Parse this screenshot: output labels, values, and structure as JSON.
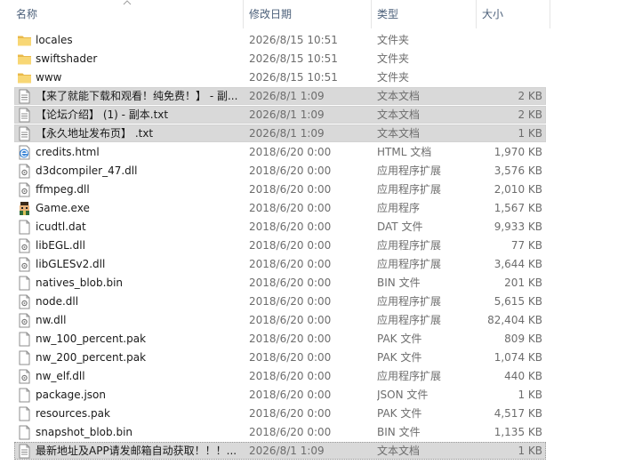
{
  "columns": {
    "name": "名称",
    "date": "修改日期",
    "type": "类型",
    "size": "大小"
  },
  "files": [
    {
      "name": "locales",
      "date": "2026/8/15 10:51",
      "type": "文件夹",
      "size": "",
      "icon": "folder-icon",
      "selected": false
    },
    {
      "name": "swiftshader",
      "date": "2026/8/15 10:51",
      "type": "文件夹",
      "size": "",
      "icon": "folder-icon",
      "selected": false
    },
    {
      "name": "www",
      "date": "2026/8/15 10:51",
      "type": "文件夹",
      "size": "",
      "icon": "folder-icon",
      "selected": false
    },
    {
      "name": "【来了就能下载和观看！纯免费！】 - 副...",
      "date": "2026/8/1 1:09",
      "type": "文本文档",
      "size": "2 KB",
      "icon": "text-file-icon",
      "selected": true
    },
    {
      "name": "【论坛介绍】 (1) - 副本.txt",
      "date": "2026/8/1 1:09",
      "type": "文本文档",
      "size": "2 KB",
      "icon": "text-file-icon",
      "selected": true
    },
    {
      "name": "【永久地址发布页】 .txt",
      "date": "2026/8/1 1:09",
      "type": "文本文档",
      "size": "1 KB",
      "icon": "text-file-icon",
      "selected": true
    },
    {
      "name": "credits.html",
      "date": "2018/6/20 0:00",
      "type": "HTML 文档",
      "size": "1,970 KB",
      "icon": "html-file-icon",
      "selected": false
    },
    {
      "name": "d3dcompiler_47.dll",
      "date": "2018/6/20 0:00",
      "type": "应用程序扩展",
      "size": "3,576 KB",
      "icon": "dll-file-icon",
      "selected": false
    },
    {
      "name": "ffmpeg.dll",
      "date": "2018/6/20 0:00",
      "type": "应用程序扩展",
      "size": "2,010 KB",
      "icon": "dll-file-icon",
      "selected": false
    },
    {
      "name": "Game.exe",
      "date": "2018/6/20 0:00",
      "type": "应用程序",
      "size": "1,567 KB",
      "icon": "game-exe-icon",
      "selected": false
    },
    {
      "name": "icudtl.dat",
      "date": "2018/6/20 0:00",
      "type": "DAT 文件",
      "size": "9,933 KB",
      "icon": "blank-file-icon",
      "selected": false
    },
    {
      "name": "libEGL.dll",
      "date": "2018/6/20 0:00",
      "type": "应用程序扩展",
      "size": "77 KB",
      "icon": "dll-file-icon",
      "selected": false
    },
    {
      "name": "libGLESv2.dll",
      "date": "2018/6/20 0:00",
      "type": "应用程序扩展",
      "size": "3,644 KB",
      "icon": "dll-file-icon",
      "selected": false
    },
    {
      "name": "natives_blob.bin",
      "date": "2018/6/20 0:00",
      "type": "BIN 文件",
      "size": "201 KB",
      "icon": "blank-file-icon",
      "selected": false
    },
    {
      "name": "node.dll",
      "date": "2018/6/20 0:00",
      "type": "应用程序扩展",
      "size": "5,615 KB",
      "icon": "dll-file-icon",
      "selected": false
    },
    {
      "name": "nw.dll",
      "date": "2018/6/20 0:00",
      "type": "应用程序扩展",
      "size": "82,404 KB",
      "icon": "dll-file-icon",
      "selected": false
    },
    {
      "name": "nw_100_percent.pak",
      "date": "2018/6/20 0:00",
      "type": "PAK 文件",
      "size": "809 KB",
      "icon": "blank-file-icon",
      "selected": false
    },
    {
      "name": "nw_200_percent.pak",
      "date": "2018/6/20 0:00",
      "type": "PAK 文件",
      "size": "1,074 KB",
      "icon": "blank-file-icon",
      "selected": false
    },
    {
      "name": "nw_elf.dll",
      "date": "2018/6/20 0:00",
      "type": "应用程序扩展",
      "size": "440 KB",
      "icon": "dll-file-icon",
      "selected": false
    },
    {
      "name": "package.json",
      "date": "2018/6/20 0:00",
      "type": "JSON 文件",
      "size": "1 KB",
      "icon": "blank-file-icon",
      "selected": false
    },
    {
      "name": "resources.pak",
      "date": "2018/6/20 0:00",
      "type": "PAK 文件",
      "size": "4,517 KB",
      "icon": "blank-file-icon",
      "selected": false
    },
    {
      "name": "snapshot_blob.bin",
      "date": "2018/6/20 0:00",
      "type": "BIN 文件",
      "size": "1,135 KB",
      "icon": "blank-file-icon",
      "selected": false
    },
    {
      "name": "最新地址及APP请发邮箱自动获取！！！...",
      "date": "2026/8/1 1:09",
      "type": "文本文档",
      "size": "1 KB",
      "icon": "text-file-icon",
      "selected": true
    }
  ],
  "colors": {
    "header_text": "#4c607a",
    "selected_bg": "#d9d9d9",
    "folder": "#f8d775"
  }
}
